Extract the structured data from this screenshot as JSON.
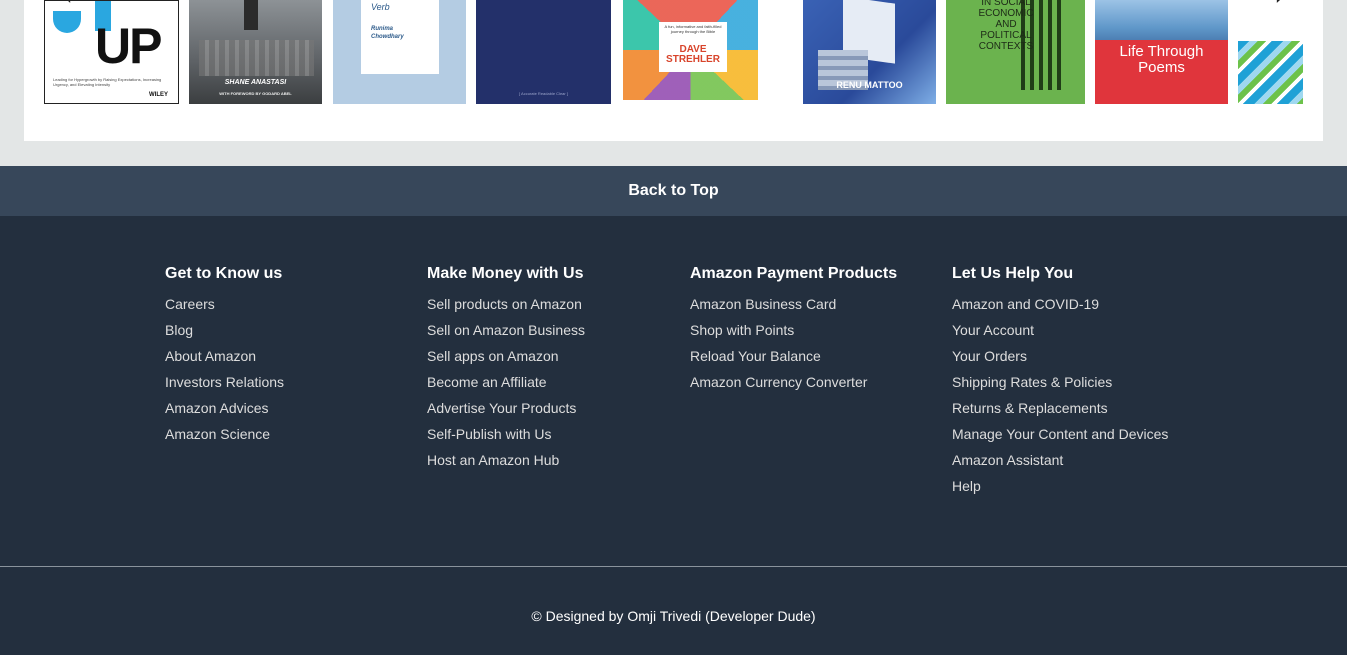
{
  "carousel": {
    "covers": [
      {
        "lines": [
          "UP",
          "Leading for Hypergrowth by Raising Expectations, Increasing Urgency, and Elevating Intensity",
          "WILEY"
        ]
      },
      {
        "lines": [
          "SHANE ANASTASI",
          "WITH FOREWORD BY GODARD ABEL"
        ]
      },
      {
        "lines": [
          "Verb",
          "Runima",
          "Chowdhary"
        ]
      },
      {
        "lines": [
          "[ Accurate Readable Clear ]"
        ]
      },
      {
        "lines": [
          "A fun, informative and faith-filled journey through the Bible",
          "DAVE",
          "STREHLER"
        ]
      },
      {
        "lines": [
          "RENU MATTOO"
        ]
      },
      {
        "lines": [
          "IN SOCIAL",
          "ECONOMIC",
          "AND",
          "POLITICAL",
          "CONTEXTS"
        ]
      },
      {
        "lines": [
          "Life Through",
          "Poems"
        ]
      },
      {
        "lines": []
      }
    ]
  },
  "back_to_top": "Back to Top",
  "footer": {
    "columns": [
      {
        "title": "Get to Know us",
        "items": [
          "Careers",
          "Blog",
          "About Amazon",
          "Investors Relations",
          "Amazon Advices",
          "Amazon Science"
        ]
      },
      {
        "title": "Make Money with Us",
        "items": [
          "Sell products on Amazon",
          "Sell on Amazon Business",
          "Sell apps on Amazon",
          "Become an Affiliate",
          "Advertise Your Products",
          "Self-Publish with Us",
          "Host an Amazon Hub"
        ]
      },
      {
        "title": "Amazon Payment Products",
        "items": [
          "Amazon Business Card",
          "Shop with Points",
          "Reload Your Balance",
          "Amazon Currency Converter"
        ]
      },
      {
        "title": "Let Us Help You",
        "items": [
          "Amazon and COVID-19",
          "Your Account",
          "Your Orders",
          "Shipping Rates & Policies",
          "Returns & Replacements",
          "Manage Your Content and Devices",
          "Amazon Assistant",
          "Help"
        ]
      }
    ]
  },
  "copyright": "© Designed by Omji Trivedi (Developer Dude)",
  "icons": {
    "prev": "chevron-left-icon",
    "next": "chevron-right-icon"
  },
  "colors": {
    "back_to_top_bg": "#37475a",
    "footer_bg": "#232f3e"
  }
}
